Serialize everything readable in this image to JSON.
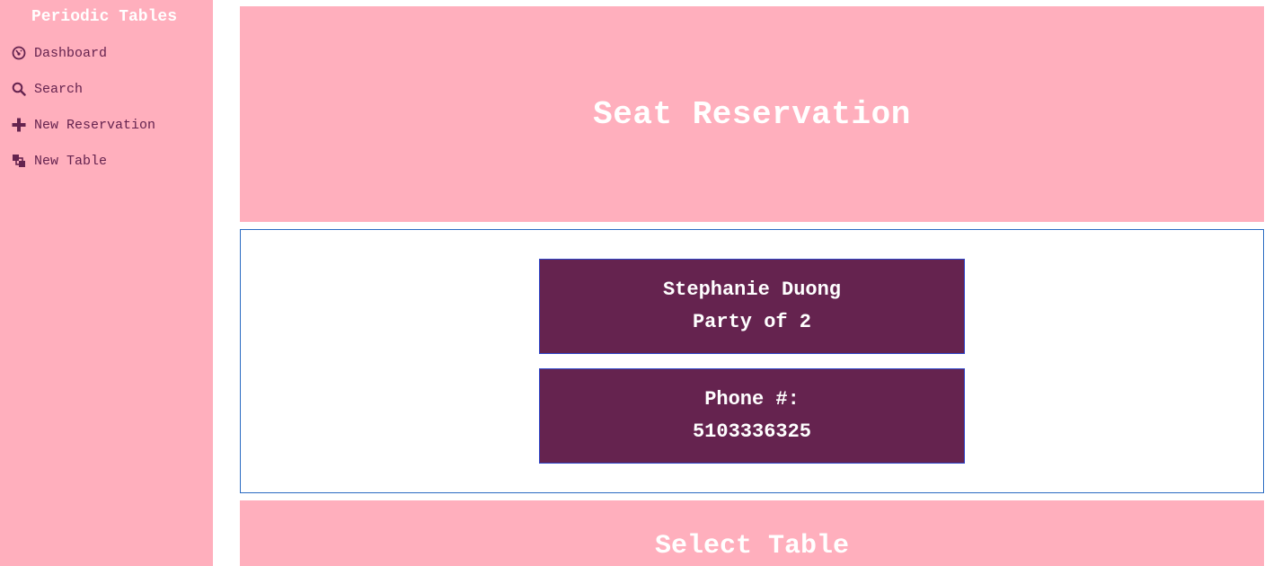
{
  "sidebar": {
    "brand": "Periodic Tables",
    "items": [
      {
        "label": "Dashboard",
        "icon": "dashboard-icon"
      },
      {
        "label": "Search",
        "icon": "search-icon"
      },
      {
        "label": "New Reservation",
        "icon": "plus-icon"
      },
      {
        "label": "New Table",
        "icon": "tables-icon"
      }
    ]
  },
  "header": {
    "title": "Seat Reservation"
  },
  "reservation": {
    "name": "Stephanie Duong",
    "party": "Party of 2",
    "phone_label": "Phone #:",
    "phone": "5103336325"
  },
  "select": {
    "title": "Select Table"
  },
  "colors": {
    "pink": "#ffafbd",
    "plum": "#65234f",
    "border_blue": "#2a6bc2"
  }
}
